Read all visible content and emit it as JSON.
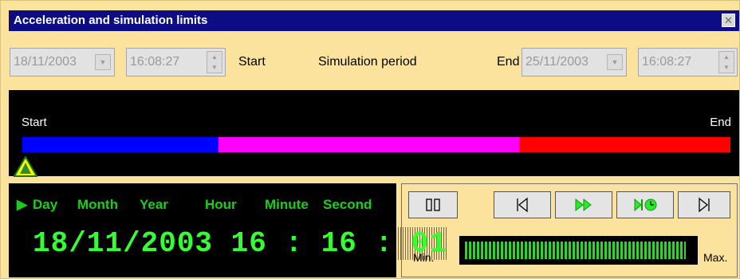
{
  "window": {
    "title": "Acceleration and simulation limits",
    "close_icon": "close-icon",
    "background_color": "#fbe39d",
    "titlebar_color": "#0c0c84"
  },
  "period": {
    "start_date": "18/11/2003",
    "start_time": "16:08:27",
    "start_label": "Start",
    "title": "Simulation period",
    "end_label": "End",
    "end_date": "25/11/2003",
    "end_time": "16:08:27"
  },
  "timeline": {
    "start_label": "Start",
    "end_label": "End",
    "segments": [
      {
        "color": "#0000ff",
        "fraction": 0.277
      },
      {
        "color": "#ff00ff",
        "fraction": 0.425
      },
      {
        "color": "#ff0000",
        "fraction": 0.298
      }
    ],
    "cursor_position": 0.0,
    "cursor_color": "#ffff00"
  },
  "clock": {
    "headers": {
      "marker": "▶",
      "day": "Day",
      "month": "Month",
      "year": "Year",
      "hour": "Hour",
      "minute": "Minute",
      "second": "Second"
    },
    "value": "18/11/2003 16 : 16 : 01",
    "digit_color": "#33ff33"
  },
  "controls": {
    "buttons": [
      {
        "name": "pause",
        "icon": "pause-icon"
      },
      {
        "name": "step-back",
        "icon": "skip-start-icon"
      },
      {
        "name": "fast-forward",
        "icon": "fast-forward-icon"
      },
      {
        "name": "play-timed",
        "icon": "play-clock-icon"
      },
      {
        "name": "step-forward",
        "icon": "skip-end-icon"
      }
    ],
    "speed": {
      "min_label": "Min.",
      "max_label": "Max.",
      "level": 1.0,
      "color": "#22dd22"
    }
  }
}
